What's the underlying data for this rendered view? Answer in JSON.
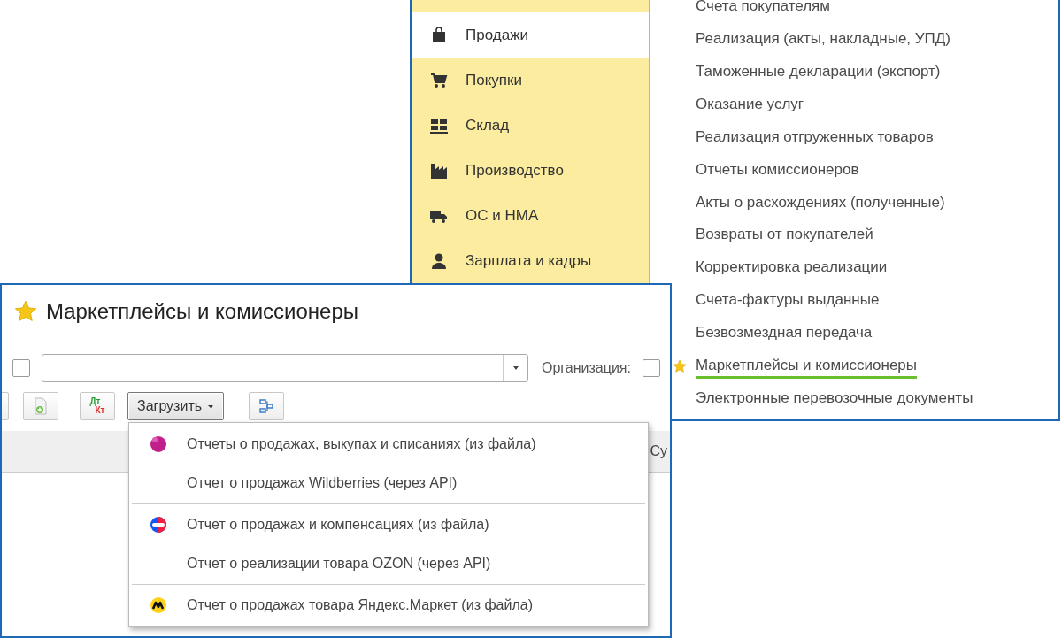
{
  "nav_window": {
    "sections": [
      {
        "label": "Продажи",
        "kind": "sales",
        "selected": true
      },
      {
        "label": "Покупки",
        "kind": "purchases",
        "selected": false
      },
      {
        "label": "Склад",
        "kind": "warehouse",
        "selected": false
      },
      {
        "label": "Производство",
        "kind": "production",
        "selected": false
      },
      {
        "label": "ОС и НМА",
        "kind": "assets",
        "selected": false
      },
      {
        "label": "Зарплата и кадры",
        "kind": "staff",
        "selected": false
      }
    ],
    "commands": [
      {
        "label": "Счета покупателям",
        "starred": false,
        "highlighted": false
      },
      {
        "label": "Реализация (акты, накладные, УПД)",
        "starred": false,
        "highlighted": false
      },
      {
        "label": "Таможенные декларации (экспорт)",
        "starred": false,
        "highlighted": false
      },
      {
        "label": "Оказание услуг",
        "starred": false,
        "highlighted": false
      },
      {
        "label": "Реализация отгруженных товаров",
        "starred": false,
        "highlighted": false
      },
      {
        "label": "Отчеты комиссионеров",
        "starred": false,
        "highlighted": false
      },
      {
        "label": "Акты о расхождениях (полученные)",
        "starred": false,
        "highlighted": false
      },
      {
        "label": "Возвраты от покупателей",
        "starred": false,
        "highlighted": false
      },
      {
        "label": "Корректировка реализации",
        "starred": false,
        "highlighted": false
      },
      {
        "label": "Счета-фактуры выданные",
        "starred": false,
        "highlighted": false
      },
      {
        "label": "Безвозмездная передача",
        "starred": false,
        "highlighted": false
      },
      {
        "label": "Маркетплейсы и комиссионеры",
        "starred": true,
        "highlighted": true
      },
      {
        "label": "Электронные перевозочные документы",
        "starred": false,
        "highlighted": false
      }
    ]
  },
  "form_window": {
    "title": "Маркетплейсы и комиссионеры",
    "starred": true,
    "filter": {
      "checked": false
    },
    "organization": {
      "label": "Организация:",
      "checked": false
    },
    "toolbar": {
      "debit_credit": [
        "Дт",
        "Кт"
      ],
      "load_button": "Загрузить"
    },
    "table": {
      "columns": [
        "Су"
      ]
    },
    "load_menu": {
      "groups": [
        [
          {
            "label": "Отчеты о продажах, выкупах и списаниях (из файла)",
            "kind": "wb"
          },
          {
            "label": "Отчет о продажах Wildberries (через API)",
            "kind": "plain"
          }
        ],
        [
          {
            "label": "Отчет о продажах и компенсациях (из файла)",
            "kind": "ozon"
          },
          {
            "label": "Отчет о реализации товара OZON (через API)",
            "kind": "plain"
          }
        ],
        [
          {
            "label": "Отчет о продажах товара Яндекс.Маркет (из файла)",
            "kind": "ym"
          }
        ]
      ]
    }
  }
}
